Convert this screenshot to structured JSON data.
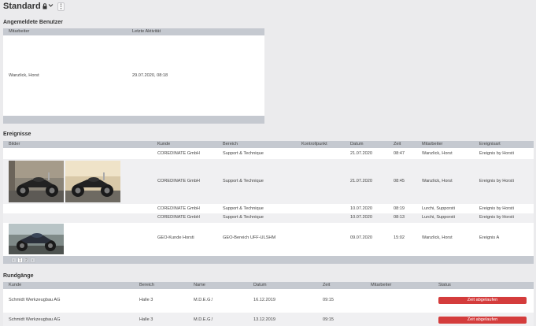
{
  "header": {
    "title": "Standard"
  },
  "logged_users": {
    "title": "Angemeldete Benutzer",
    "columns": [
      "Mitarbeiter",
      "Letzte Aktivität"
    ],
    "rows": [
      {
        "mitarbeiter": "Wanzlick, Horst",
        "aktivitaet": "29.07.2020, 08:18"
      }
    ]
  },
  "events": {
    "title": "Ereignisse",
    "columns": [
      "Bilder",
      "Kunde",
      "Bereich",
      "Kontrollpunkt",
      "Datum",
      "Zeit",
      "Mitarbeiter",
      "Ereignisart"
    ],
    "rows": [
      {
        "kunde": "COREDINATE GmbH",
        "bereich": "Support & Technique",
        "kontrollpunkt": "",
        "datum": "21.07.2020",
        "zeit": "08:47",
        "mitarbeiter": "Wanzlick, Horst",
        "ereignisart": "Ereignis by Horsti"
      },
      {
        "kunde": "COREDINATE GmbH",
        "bereich": "Support & Technique",
        "kontrollpunkt": "",
        "datum": "21.07.2020",
        "zeit": "08:45",
        "mitarbeiter": "Wanzlick, Horst",
        "ereignisart": "Ereignis by Horsti"
      },
      {
        "kunde": "COREDINATE GmbH",
        "bereich": "Support & Technique",
        "kontrollpunkt": "",
        "datum": "10.07.2020",
        "zeit": "08:19",
        "mitarbeiter": "Lurchi, Supporsti",
        "ereignisart": "Ereignis by Horsti"
      },
      {
        "kunde": "COREDINATE GmbH",
        "bereich": "Support & Technique",
        "kontrollpunkt": "",
        "datum": "10.07.2020",
        "zeit": "08:13",
        "mitarbeiter": "Lurchi, Supporsti",
        "ereignisart": "Ereignis by Horsti"
      },
      {
        "kunde": "GEO-Kunde Horsti",
        "bereich": "GEO-Bereich UFF-ULSHM",
        "kontrollpunkt": "",
        "datum": "09.07.2020",
        "zeit": "15:02",
        "mitarbeiter": "Wanzlick, Horst",
        "ereignisart": "Ereignis A"
      }
    ],
    "pager": {
      "prev": "‹",
      "pages": [
        "1",
        "2"
      ],
      "next": "›"
    }
  },
  "rounds": {
    "title": "Rundgänge",
    "columns": [
      "Kunde",
      "Bereich",
      "Name",
      "Datum",
      "Zeit",
      "Mitarbeiter",
      "Status"
    ],
    "rows": [
      {
        "kunde": "Schmidt Werkzeugbau AG",
        "bereich": "Halle 3",
        "name": "M.D.E.G.!",
        "datum": "16.12.2019",
        "zeit": "09:15",
        "mitarbeiter": "",
        "status": "Zeit abgelaufen"
      },
      {
        "kunde": "Schmidt Werkzeugbau AG",
        "bereich": "Halle 3",
        "name": "M.D.E.G.!",
        "datum": "13.12.2019",
        "zeit": "09:15",
        "mitarbeiter": "",
        "status": "Zeit abgelaufen"
      }
    ]
  },
  "icons": {
    "lock": "lock-icon",
    "chevron": "chevron-down-icon",
    "menu": "more-vertical-icon",
    "photo": "motorcycle-photo"
  },
  "colors": {
    "status_expired": "#d43c3c",
    "header_bg": "#c5c9d0",
    "page_bg": "#ebebed"
  }
}
